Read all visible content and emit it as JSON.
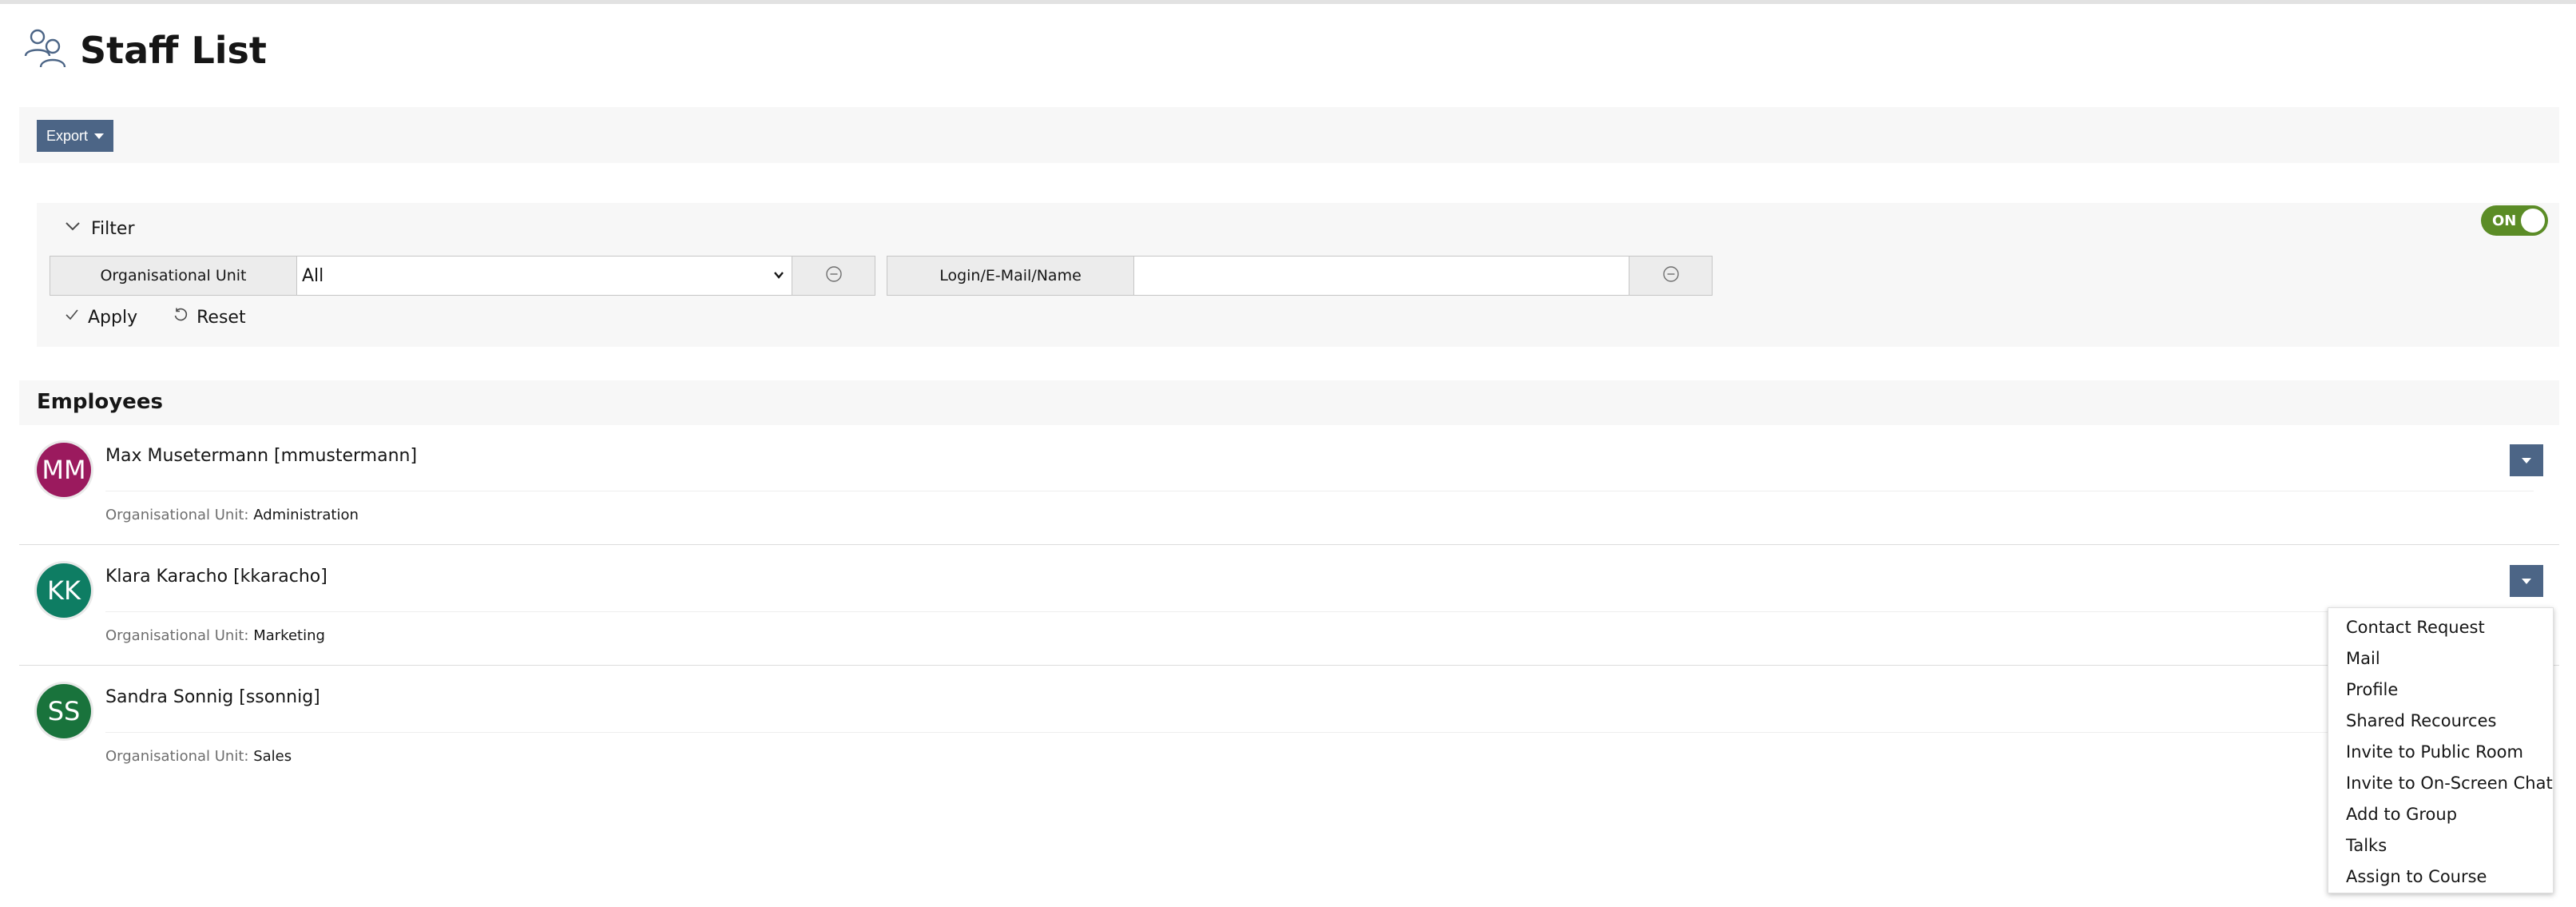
{
  "page": {
    "title": "Staff List",
    "icon": "users-icon"
  },
  "toolbar": {
    "export_label": "Export"
  },
  "filter": {
    "title": "Filter",
    "toggle_label": "ON",
    "toggle_state": "on",
    "fields": [
      {
        "label": "Organisational Unit",
        "type": "select",
        "value": "All"
      },
      {
        "label": "Login/E-Mail/Name",
        "type": "text",
        "value": ""
      }
    ],
    "apply_label": "Apply",
    "reset_label": "Reset"
  },
  "employees": {
    "title": "Employees",
    "ou_label": "Organisational Unit:",
    "items": [
      {
        "initials": "MM",
        "name": "Max Musetermann [mmustermann]",
        "ou": "Administration",
        "avatar_color": "#9b1a5e"
      },
      {
        "initials": "KK",
        "name": "Klara Karacho [kkaracho]",
        "ou": "Marketing",
        "avatar_color": "#0e7d63"
      },
      {
        "initials": "SS",
        "name": "Sandra Sonnig [ssonnig]",
        "ou": "Sales",
        "avatar_color": "#19733c"
      }
    ]
  },
  "dropdown": {
    "items": [
      "Contact Request",
      "Mail",
      "Profile",
      "Shared Recources",
      "Invite to Public Room",
      "Invite to On-Screen Chat",
      "Add to Group",
      "Talks",
      "Assign to Course"
    ]
  },
  "colors": {
    "accent": "#4c6586",
    "toggle_on": "#5b8c26"
  }
}
